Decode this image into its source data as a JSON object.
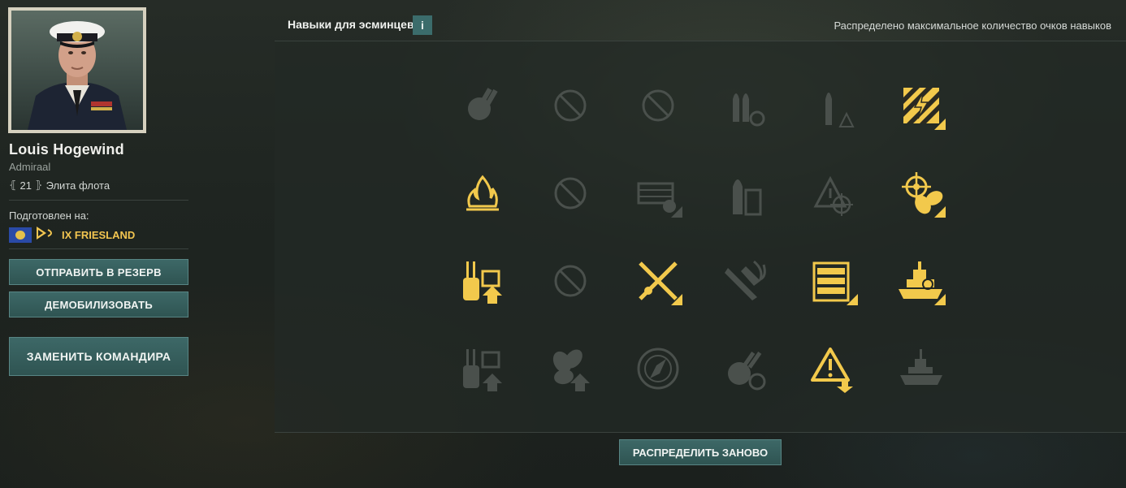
{
  "commander": {
    "name": "Louis Hogewind",
    "rank": "Admiraal",
    "points": "21",
    "elite_label": "Элита флота",
    "trained_label": "Подготовлен на:",
    "ship": "IX FRIESLAND"
  },
  "buttons": {
    "reserve": "ОТПРАВИТЬ В РЕЗЕРВ",
    "demobilize": "ДЕМОБИЛИЗОВАТЬ",
    "replace": "ЗАМЕНИТЬ КОМАНДИРА",
    "redistribute": "РАСПРЕДЕЛИТЬ ЗАНОВО"
  },
  "skills_header": {
    "title": "Навыки для эсминцев",
    "info_label": "i",
    "status": "Распределено максимальное количество очков навыков"
  },
  "colors": {
    "active": "#f2c94c",
    "inactive": "#4a504c",
    "accent_button": "#3b6c6b"
  },
  "skills": [
    [
      {
        "icon": "gun-feeder-icon",
        "state": "inactive"
      },
      {
        "icon": "unavailable-icon",
        "state": "inactive"
      },
      {
        "icon": "unavailable-icon",
        "state": "inactive"
      },
      {
        "icon": "shell-reload-icon",
        "state": "inactive"
      },
      {
        "icon": "shell-warning-icon",
        "state": "inactive"
      },
      {
        "icon": "priority-target-hazard-icon",
        "state": "active"
      }
    ],
    [
      {
        "icon": "fire-icon",
        "state": "active"
      },
      {
        "icon": "unavailable-icon",
        "state": "inactive"
      },
      {
        "icon": "torpedo-launcher-icon",
        "state": "inactive"
      },
      {
        "icon": "ammo-shell-icon",
        "state": "inactive"
      },
      {
        "icon": "warning-aim-icon",
        "state": "inactive"
      },
      {
        "icon": "helm-propeller-icon",
        "state": "active"
      }
    ],
    [
      {
        "icon": "turret-upgrade-icon",
        "state": "active"
      },
      {
        "icon": "unavailable-icon",
        "state": "inactive"
      },
      {
        "icon": "crossed-weapons-icon",
        "state": "active"
      },
      {
        "icon": "burning-plane-icon",
        "state": "inactive"
      },
      {
        "icon": "torpedo-rack-icon",
        "state": "active"
      },
      {
        "icon": "battleship-icon",
        "state": "active"
      }
    ],
    [
      {
        "icon": "turret-upgrade-2-icon",
        "state": "inactive"
      },
      {
        "icon": "propeller-upgrade-icon",
        "state": "inactive"
      },
      {
        "icon": "compass-icon",
        "state": "inactive"
      },
      {
        "icon": "aa-reload-icon",
        "state": "inactive"
      },
      {
        "icon": "warning-down-icon",
        "state": "active"
      },
      {
        "icon": "ship-silhouette-icon",
        "state": "inactive"
      }
    ]
  ]
}
